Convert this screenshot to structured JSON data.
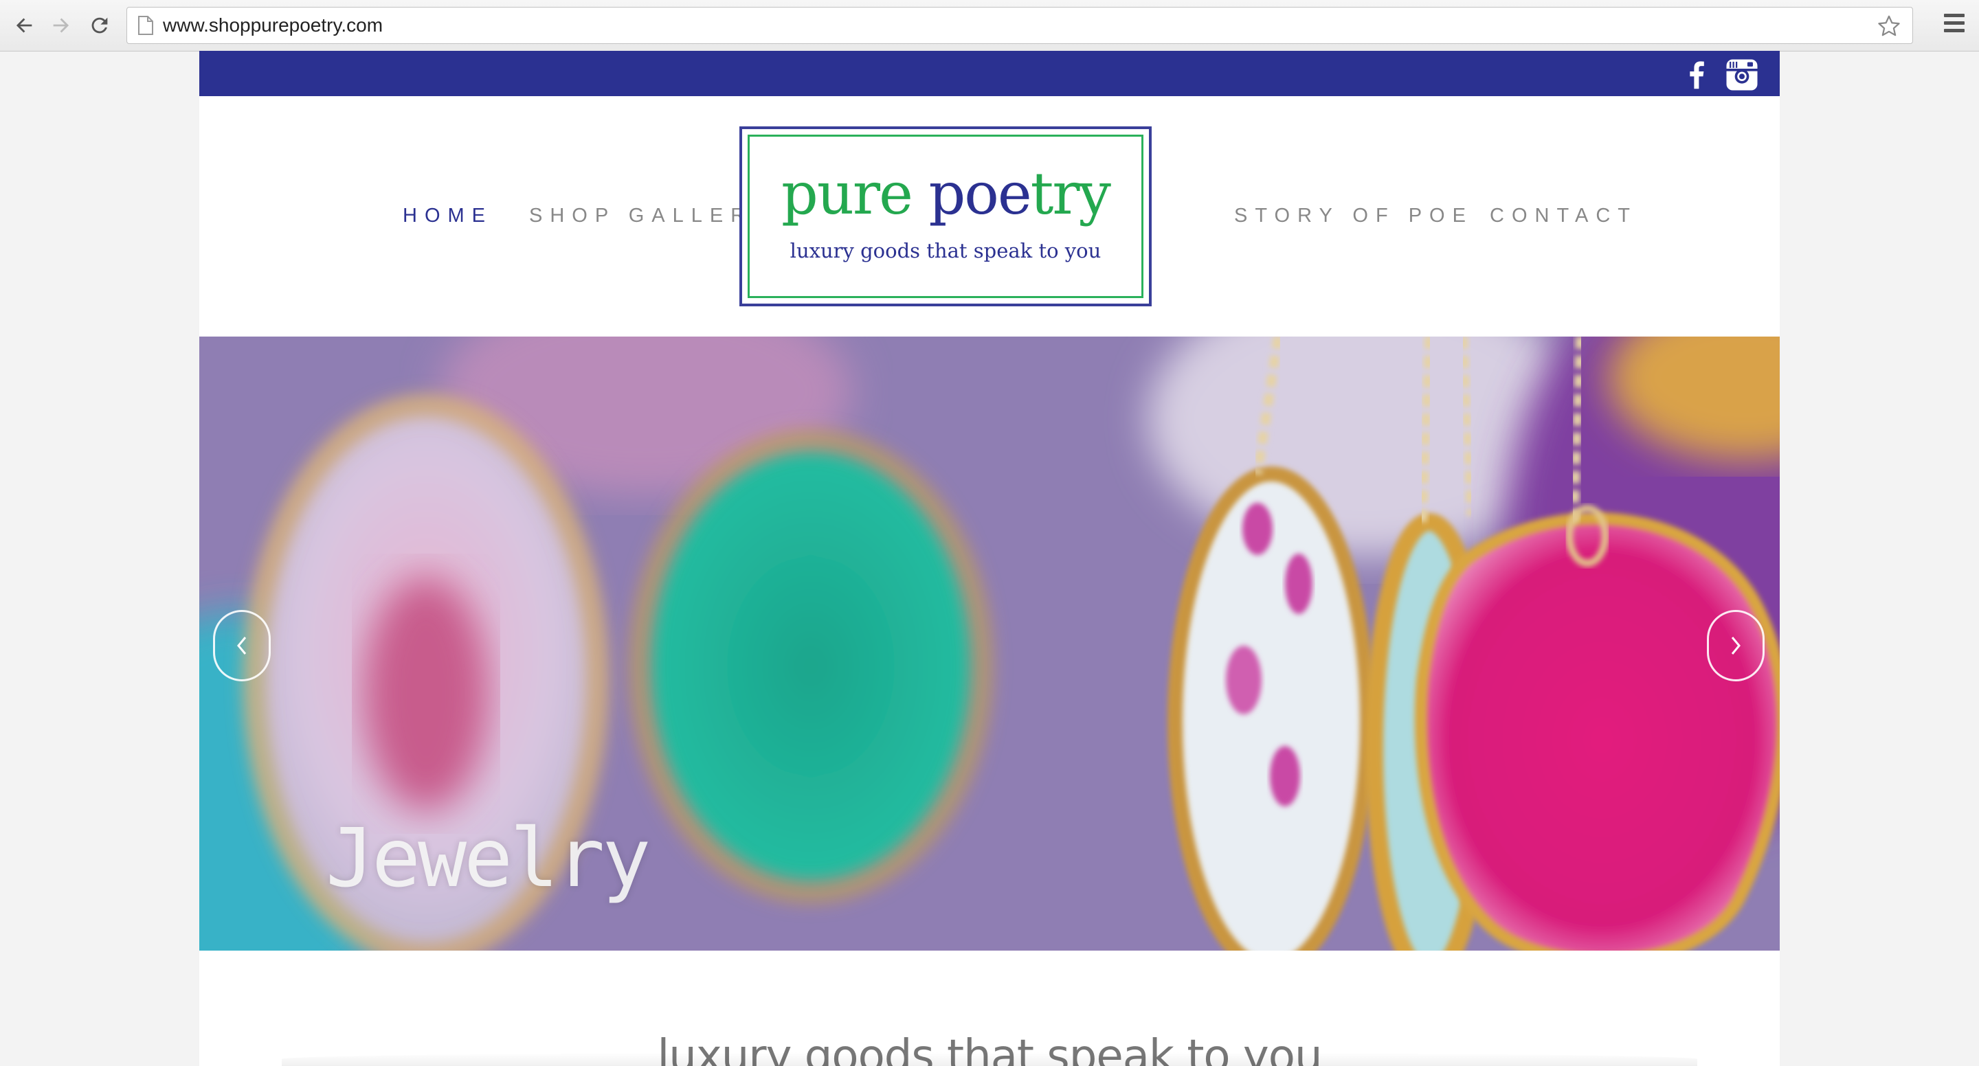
{
  "browser": {
    "url": "www.shoppurepoetry.com",
    "back_icon": "arrow-left-icon",
    "forward_icon": "arrow-right-icon",
    "reload_icon": "reload-icon",
    "bookmark_icon": "star-icon",
    "menu_icon": "hamburger-menu-icon"
  },
  "site": {
    "topbar": {
      "color": "#2b3191",
      "social": [
        {
          "icon": "facebook-icon"
        },
        {
          "icon": "instagram-icon"
        }
      ]
    },
    "nav": {
      "home": "HOME",
      "shop_gallery": "SHOP GALLERY",
      "story": "STORY OF POE",
      "contact": "CONTACT"
    },
    "logo": {
      "word1": "pure",
      "word2_part1": "poe",
      "word2_part2": "try",
      "tagline": "luxury goods that speak to you",
      "green": "#24a84f",
      "blue": "#2b3191"
    },
    "hero": {
      "caption": "Jewelry",
      "prev_icon": "chevron-left-icon",
      "next_icon": "chevron-right-icon"
    },
    "subtitle": "luxury goods that speak to you"
  }
}
